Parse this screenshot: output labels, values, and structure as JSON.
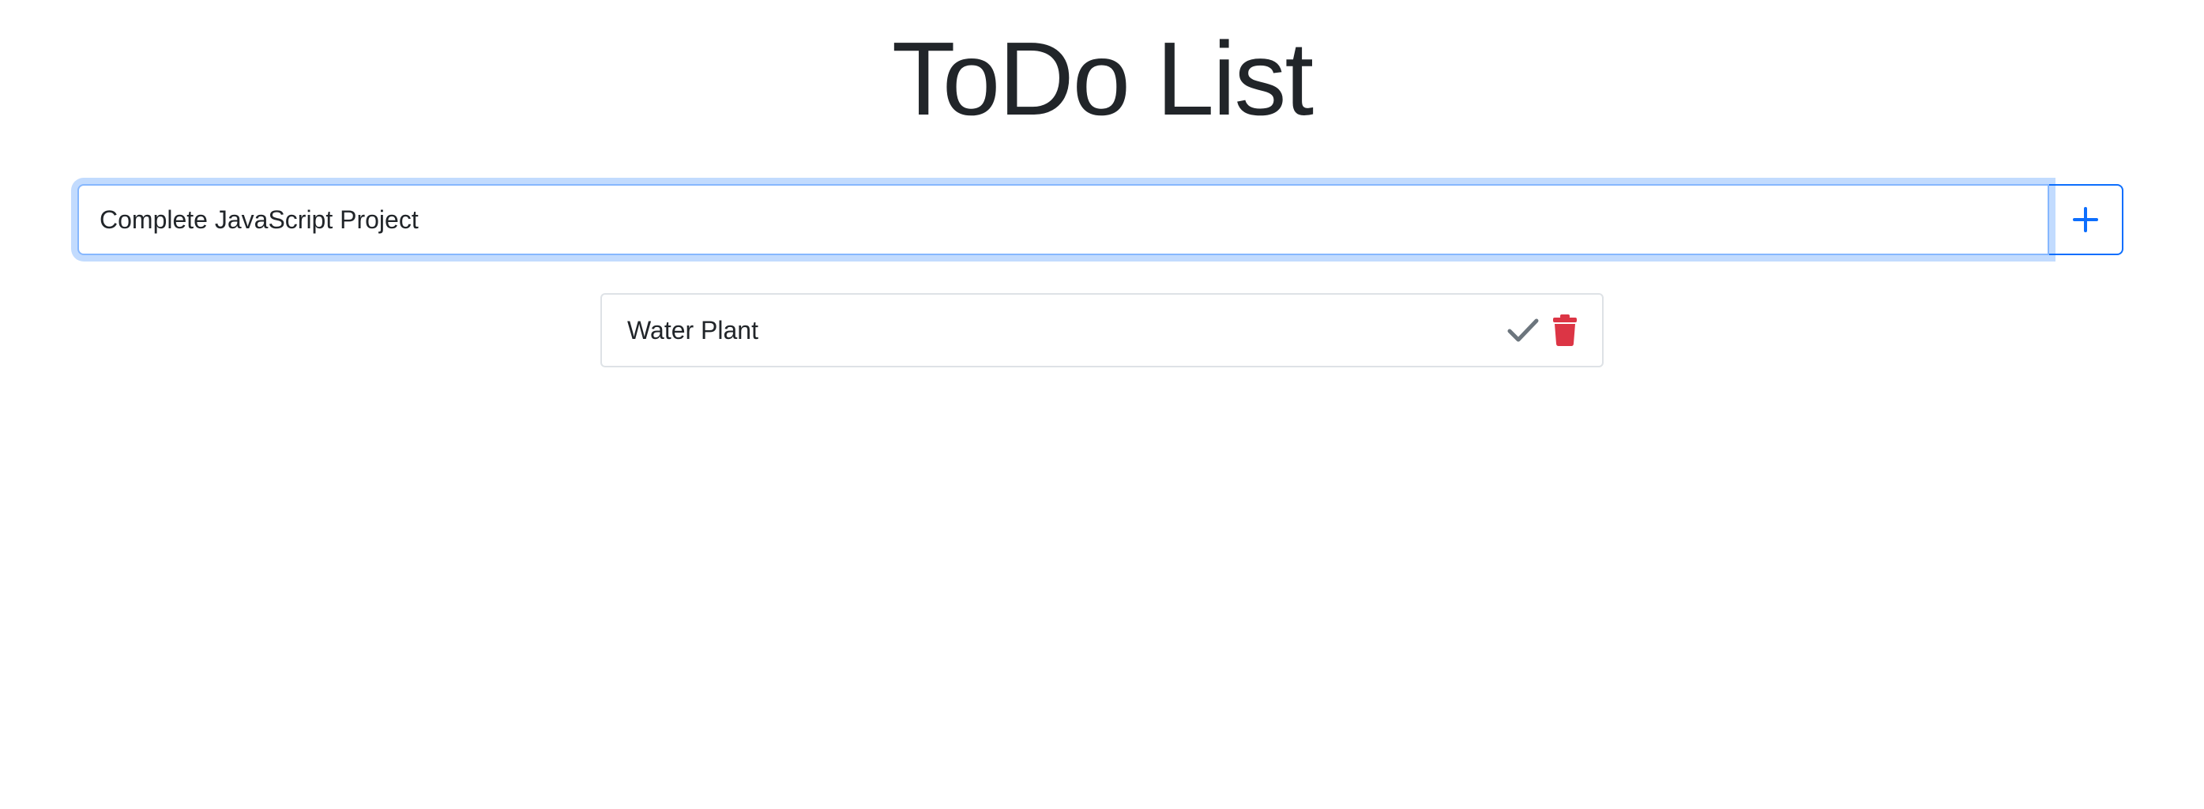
{
  "header": {
    "title": "ToDo List"
  },
  "add_form": {
    "input_value": "Complete JavaScript Project",
    "add_icon": "plus-icon",
    "accent_color": "#0d6efd"
  },
  "todos": [
    {
      "text": "Water Plant",
      "complete_icon": "check-icon",
      "delete_icon": "trash-icon",
      "check_color": "#6c757d",
      "delete_color": "#dc3545"
    }
  ]
}
